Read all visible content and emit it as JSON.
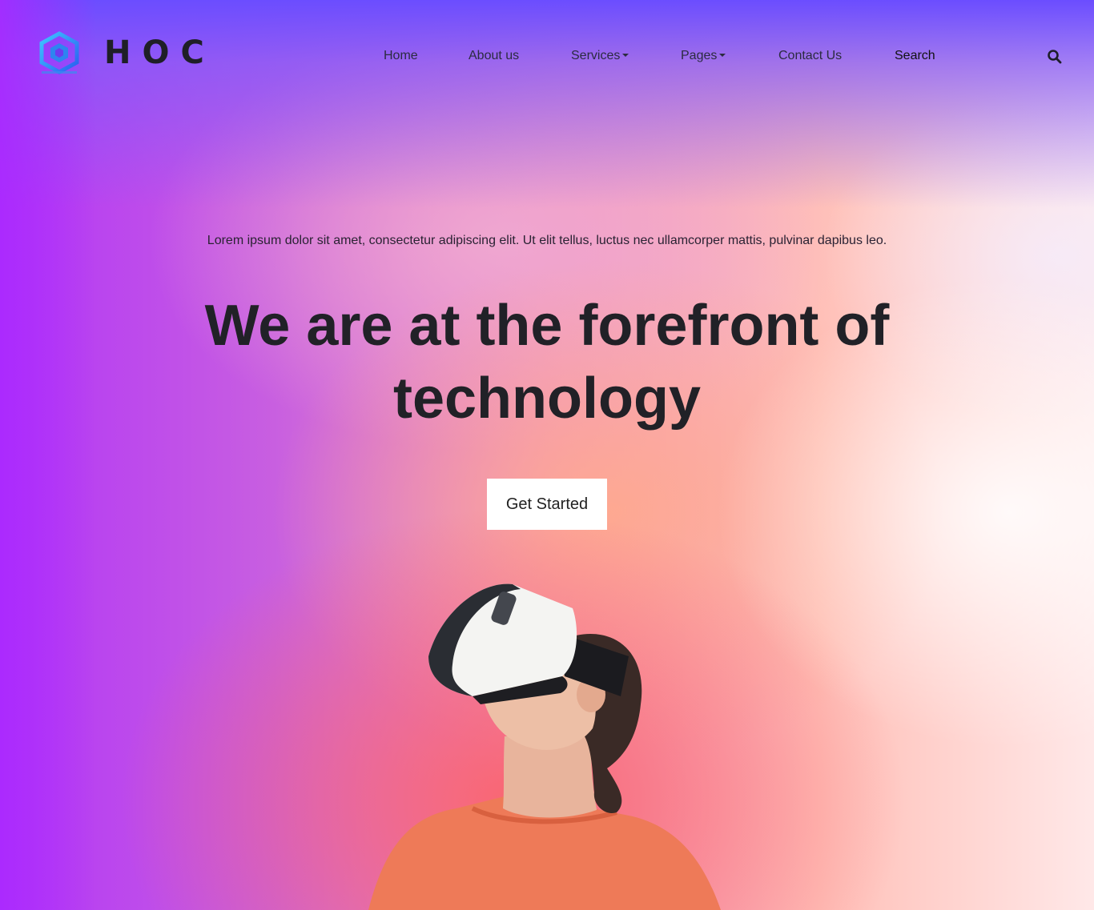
{
  "header": {
    "brand": "HOC",
    "logo_icon": "hexagon-logo-icon",
    "nav": [
      {
        "label": "Home",
        "has_dropdown": false
      },
      {
        "label": "About us",
        "has_dropdown": false
      },
      {
        "label": "Services",
        "has_dropdown": true
      },
      {
        "label": "Pages",
        "has_dropdown": true
      },
      {
        "label": "Contact Us",
        "has_dropdown": false
      },
      {
        "label": "Search",
        "has_dropdown": false
      }
    ],
    "search_icon": "search-icon"
  },
  "hero": {
    "tagline": "Lorem ipsum dolor sit amet, consectetur adipiscing elit. Ut elit tellus, luctus nec ullamcorper mattis, pulvinar dapibus leo.",
    "headline": "We are at the forefront of technology",
    "cta_label": "Get Started",
    "image": "woman-vr-headset-image"
  },
  "colors": {
    "accent_purple": "#6b4dff",
    "magenta": "#b236f7",
    "coral": "#f9685f",
    "text_dark": "#212127",
    "logo_blue": "#2aa8f0"
  }
}
